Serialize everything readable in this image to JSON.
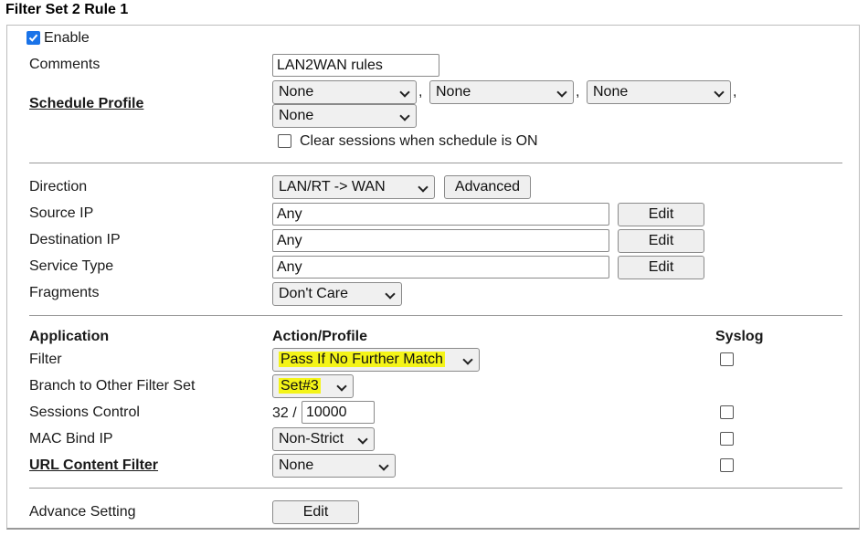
{
  "page_title": "Filter Set 2 Rule 1",
  "enable": {
    "label": "Enable",
    "checked": true
  },
  "comments": {
    "label": "Comments",
    "value": "LAN2WAN rules"
  },
  "schedule": {
    "label": "Schedule Profile",
    "profiles": [
      "None",
      "None",
      "None",
      "None"
    ],
    "separator": ",",
    "clear_sessions": {
      "label": "Clear sessions when schedule is ON",
      "checked": false
    }
  },
  "direction": {
    "label": "Direction",
    "value": "LAN/RT -> WAN",
    "advanced_label": "Advanced"
  },
  "source_ip": {
    "label": "Source IP",
    "value": "Any",
    "edit_label": "Edit"
  },
  "destination_ip": {
    "label": "Destination IP",
    "value": "Any",
    "edit_label": "Edit"
  },
  "service_type": {
    "label": "Service Type",
    "value": "Any",
    "edit_label": "Edit"
  },
  "fragments": {
    "label": "Fragments",
    "value": "Don't Care"
  },
  "headers": {
    "application": "Application",
    "action_profile": "Action/Profile",
    "syslog": "Syslog"
  },
  "filter": {
    "label": "Filter",
    "value": "Pass If No Further Match",
    "syslog": false
  },
  "branch": {
    "label": "Branch to Other Filter Set",
    "value": "Set#3"
  },
  "sessions_control": {
    "label": "Sessions Control",
    "current": "32 /",
    "limit": "10000",
    "syslog": false
  },
  "mac_bind": {
    "label": "MAC Bind IP",
    "value": "Non-Strict",
    "syslog": false
  },
  "url_filter": {
    "label": "URL Content Filter",
    "value": "None",
    "syslog": false
  },
  "advance_setting": {
    "label": "Advance Setting",
    "edit_label": "Edit"
  },
  "colors": {
    "highlight": "#f4f418",
    "checkbox_checked": "#1a73e8"
  }
}
